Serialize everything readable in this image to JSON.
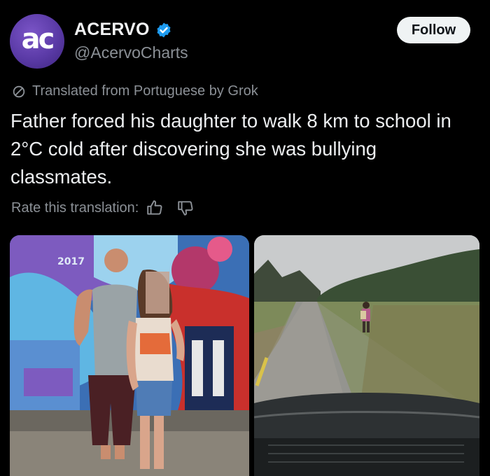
{
  "post": {
    "avatar_text": "ac",
    "author_name": "ACERVO",
    "author_handle": "@AcervoCharts",
    "follow_label": "Follow",
    "translated_label": "Translated from Portuguese by Grok",
    "text": "Father forced his daughter to walk 8 km to school in 2°C cold after discovering she was bullying classmates.",
    "rate_label": "Rate this translation:"
  },
  "media": {
    "left_image_text": "2017"
  },
  "icons": {
    "verified": "verified-badge-icon",
    "translate": "translate-icon",
    "thumbs_up": "thumbs-up-icon",
    "thumbs_down": "thumbs-down-icon"
  },
  "colors": {
    "background": "#000000",
    "verified_blue": "#1d9bf0",
    "avatar_purple": "#5a3aa6",
    "muted_text": "#8b9096"
  }
}
